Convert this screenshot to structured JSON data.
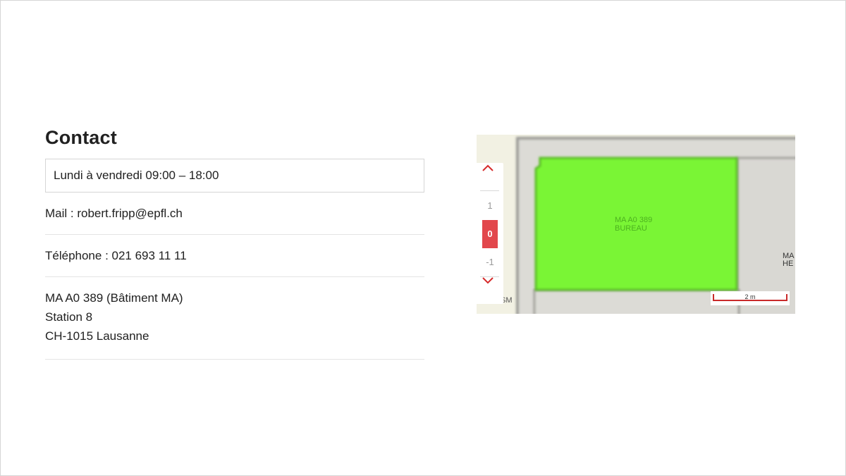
{
  "contact": {
    "title": "Contact",
    "hours": "Lundi à vendredi 09:00 – 18:00",
    "mail": "Mail : robert.fripp@epfl.ch",
    "phone": "Téléphone : 021 693 11 11",
    "address": [
      "MA A0 389 (Bâtiment MA)",
      "Station 8",
      "CH-1015 Lausanne"
    ]
  },
  "map": {
    "room_label": "MA A0 389",
    "room_type": "BUREAU",
    "adjacent_label_1": "MA",
    "adjacent_label_2": "HE",
    "attribution": "SM",
    "floors": [
      "1",
      "0",
      "-1"
    ],
    "active_floor": "0",
    "scale_label": "2 m",
    "highlight_color": "#7af535",
    "active_floor_color": "#e2474c",
    "icons": {
      "up": "chevron-up-icon",
      "down": "chevron-down-icon"
    }
  }
}
